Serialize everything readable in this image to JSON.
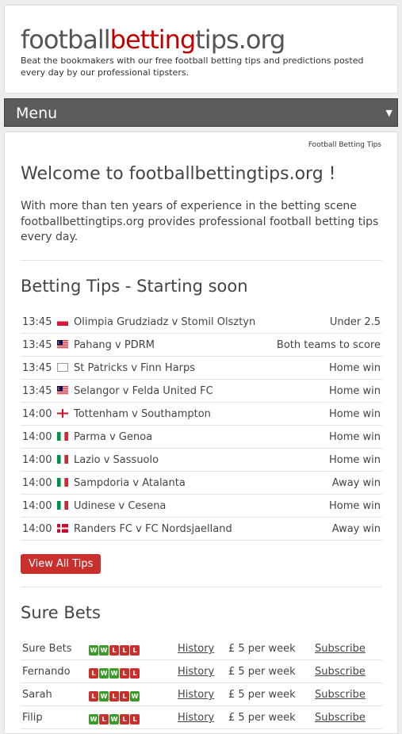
{
  "header": {
    "logo_part1": "football",
    "logo_part2": "betting",
    "logo_part3": "tips.org",
    "tagline": "Beat the bookmakers with our free football betting tips and predictions posted every day by our professional tipsters."
  },
  "menu": {
    "label": "Menu",
    "arrow": "▼"
  },
  "breadcrumb": "Football Betting Tips",
  "welcome": {
    "title": "Welcome to footballbettingtips.org !",
    "text": "With more than ten years of experience in the betting scene footballbettingtips.org provides professional football betting tips every day."
  },
  "tips_section": {
    "title": "Betting Tips - Starting soon",
    "rows": [
      {
        "time": "13:45",
        "flag": "poland",
        "match": "Olimpia Grudziadz v Stomil Olsztyn",
        "prediction": "Under 2.5"
      },
      {
        "time": "13:45",
        "flag": "malaysia",
        "match": "Pahang v PDRM",
        "prediction": "Both teams to score"
      },
      {
        "time": "13:45",
        "flag": "blank",
        "match": "St Patricks v Finn Harps",
        "prediction": "Home win"
      },
      {
        "time": "13:45",
        "flag": "malaysia",
        "match": "Selangor v Felda United FC",
        "prediction": "Home win"
      },
      {
        "time": "14:00",
        "flag": "england",
        "match": "Tottenham v Southampton",
        "prediction": "Home win"
      },
      {
        "time": "14:00",
        "flag": "italy",
        "match": "Parma v Genoa",
        "prediction": "Home win"
      },
      {
        "time": "14:00",
        "flag": "italy",
        "match": "Lazio v Sassuolo",
        "prediction": "Home win"
      },
      {
        "time": "14:00",
        "flag": "italy",
        "match": "Sampdoria v Atalanta",
        "prediction": "Away win"
      },
      {
        "time": "14:00",
        "flag": "italy",
        "match": "Udinese v Cesena",
        "prediction": "Home win"
      },
      {
        "time": "14:00",
        "flag": "denmark",
        "match": "Randers FC v FC Nordsjaelland",
        "prediction": "Away win"
      }
    ],
    "button_label": "View All Tips"
  },
  "sure_section": {
    "title": "Sure Bets",
    "history_label": "History",
    "subscribe_label": "Subscribe",
    "rows": [
      {
        "name": "Sure Bets",
        "form": [
          "W",
          "W",
          "L",
          "L",
          "L"
        ],
        "price": "£ 5 per week"
      },
      {
        "name": "Fernando",
        "form": [
          "L",
          "W",
          "W",
          "L",
          "L"
        ],
        "price": "£ 5 per week"
      },
      {
        "name": "Sarah",
        "form": [
          "L",
          "W",
          "L",
          "L",
          "W"
        ],
        "price": "£ 5 per week"
      },
      {
        "name": "Filip",
        "form": [
          "W",
          "L",
          "W",
          "L",
          "L"
        ],
        "price": "£ 5 per week"
      }
    ]
  },
  "colors": {
    "brand_red": "#c00000",
    "button_red": "#c9302c",
    "win_green": "#3c9a2b",
    "menu_bg": "#5c5c5c"
  }
}
